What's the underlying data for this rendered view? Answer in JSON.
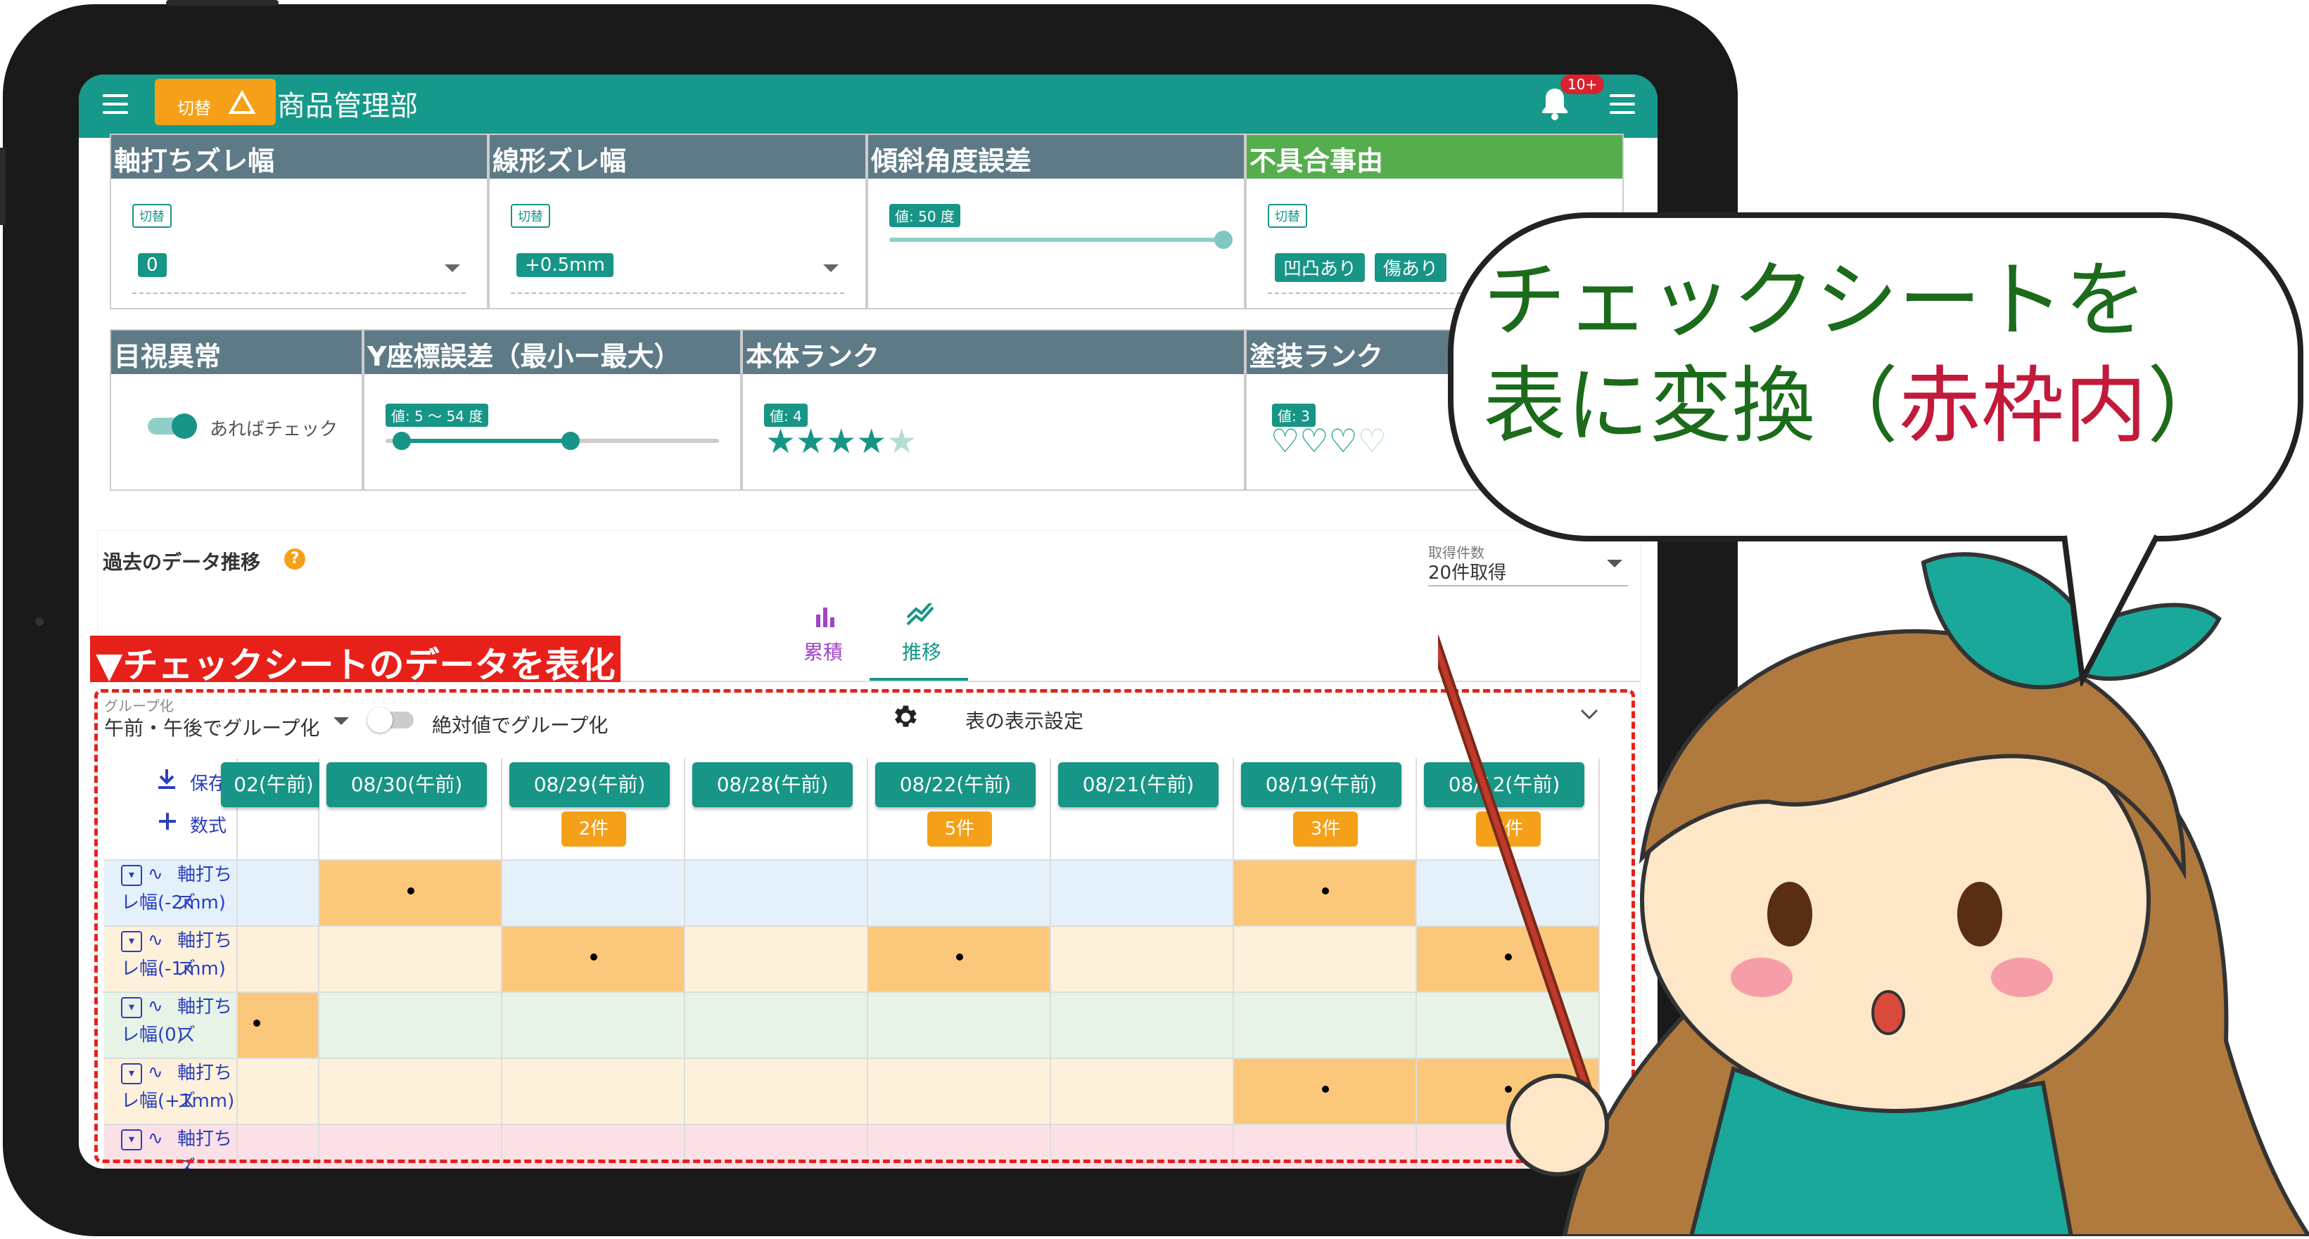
{
  "app": {
    "department": "商品管理部",
    "switch_label": "切替",
    "notification_badge": "10+"
  },
  "panels_row1": [
    {
      "title": "軸打ちズレ幅",
      "chip": "切替",
      "value": "0",
      "head": "gray"
    },
    {
      "title": "線形ズレ幅",
      "chip": "切替",
      "value": "+0.5mm",
      "head": "gray"
    },
    {
      "title": "傾斜角度誤差",
      "value_label": "値: 50 度",
      "head": "gray"
    },
    {
      "title": "不具合事由",
      "chip": "切替",
      "tags": [
        "凹凸あり",
        "傷あり"
      ],
      "head": "green"
    }
  ],
  "panels_row2": [
    {
      "title": "目視異常",
      "toggle_label": "あればチェック"
    },
    {
      "title": "Y座標誤差（最小ー最大）",
      "value_label": "値: 5 〜 54 度",
      "range": [
        5,
        54
      ]
    },
    {
      "title": "本体ランク",
      "value_label": "値: 4",
      "rating": 4,
      "max": 5
    },
    {
      "title": "塗装ランク",
      "value_label": "値: 3",
      "rating": 3,
      "max": 5
    }
  ],
  "history": {
    "title": "過去のデータ推移",
    "fetch_label": "取得件数",
    "fetch_value": "20件取得",
    "tab_cumulative": "累積",
    "tab_trend": "推移"
  },
  "annotation_title": "▼チェックシートのデータを表化",
  "table_controls": {
    "group_label": "グループ化",
    "group_value": "午前・午後でグループ化",
    "absolute_group": "絶対値でグループ化",
    "display_settings": "表の表示設定",
    "save": "保存",
    "formula": "数式"
  },
  "columns": [
    {
      "date": "02(午前)",
      "count": ""
    },
    {
      "date": "08/30(午前)",
      "count": ""
    },
    {
      "date": "08/29(午前)",
      "count": "2件"
    },
    {
      "date": "08/28(午前)",
      "count": ""
    },
    {
      "date": "08/22(午前)",
      "count": "5件"
    },
    {
      "date": "08/21(午前)",
      "count": ""
    },
    {
      "date": "08/19(午前)",
      "count": "3件"
    },
    {
      "date": "08/12(午前)",
      "count": "3件"
    }
  ],
  "rows": [
    {
      "label_1": "軸打ちズ",
      "label_2": "レ幅(-2mm)",
      "marks": [
        1,
        6
      ]
    },
    {
      "label_1": "軸打ちズ",
      "label_2": "レ幅(-1mm)",
      "marks": [
        2,
        4,
        7
      ]
    },
    {
      "label_1": "軸打ちズ",
      "label_2": "レ幅(0)",
      "marks": [
        0
      ]
    },
    {
      "label_1": "軸打ちズ",
      "label_2": "レ幅(+1mm)",
      "marks": [
        6,
        7
      ]
    },
    {
      "label_1": "軸打ちズ",
      "label_2": "",
      "marks": []
    }
  ],
  "speech_bubble": {
    "line1": "チェックシートを",
    "line2_a": "表に変換（",
    "line2_b": "赤枠内",
    "line2_c": "）"
  },
  "colors": {
    "teal": "#16998a",
    "orange": "#f5a018",
    "annotation_red": "#e8201a"
  }
}
